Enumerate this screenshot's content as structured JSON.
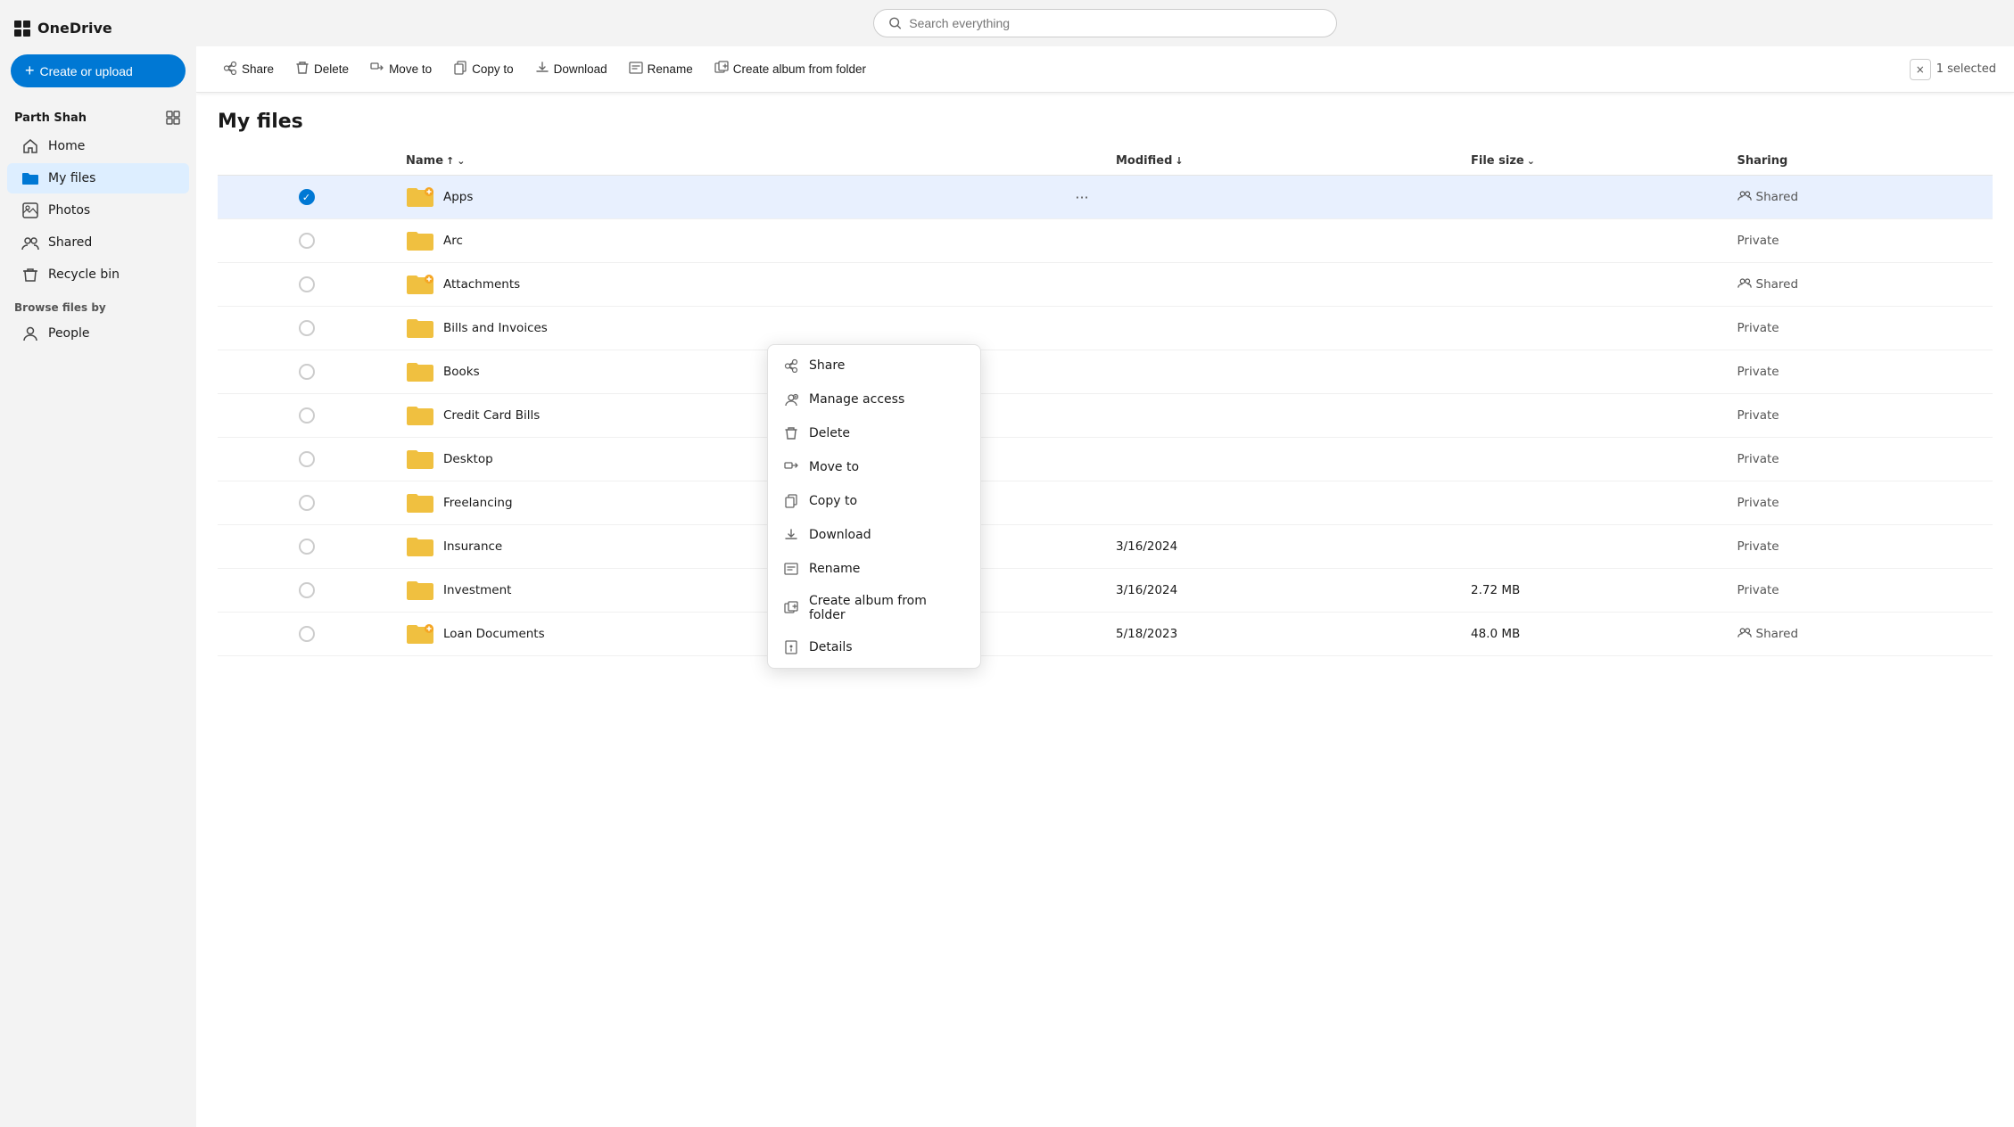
{
  "app": {
    "name": "OneDrive"
  },
  "logo": {
    "grid_icon": "grid-icon"
  },
  "create_button": {
    "label": "Create or upload",
    "plus": "+"
  },
  "user": {
    "name": "Parth Shah",
    "expand_icon": "expand-sidebar-icon"
  },
  "nav": {
    "items": [
      {
        "id": "home",
        "label": "Home",
        "icon": "home-icon"
      },
      {
        "id": "my-files",
        "label": "My files",
        "icon": "folder-icon",
        "active": true
      },
      {
        "id": "photos",
        "label": "Photos",
        "icon": "photos-icon"
      },
      {
        "id": "shared",
        "label": "Shared",
        "icon": "shared-icon"
      },
      {
        "id": "recycle-bin",
        "label": "Recycle bin",
        "icon": "recycle-icon"
      }
    ],
    "browse_label": "Browse files by",
    "browse_items": [
      {
        "id": "people",
        "label": "People",
        "icon": "people-icon"
      }
    ]
  },
  "search": {
    "placeholder": "Search everything"
  },
  "toolbar": {
    "share_label": "Share",
    "delete_label": "Delete",
    "move_to_label": "Move to",
    "copy_to_label": "Copy to",
    "download_label": "Download",
    "rename_label": "Rename",
    "create_album_label": "Create album from folder",
    "selection_text": "1 selected",
    "close_icon": "×"
  },
  "page": {
    "title": "My files"
  },
  "table": {
    "headers": {
      "name": "Name",
      "sort_asc": "↑",
      "sort_icon": "⌄",
      "modified": "Modified",
      "modified_sort": "↓",
      "file_size": "File size",
      "file_size_sort": "⌄",
      "sharing": "Sharing"
    },
    "rows": [
      {
        "id": "apps",
        "name": "Apps",
        "modified": "",
        "size": "",
        "sharing": "Shared",
        "is_shared": true,
        "special_icon": true,
        "selected": true
      },
      {
        "id": "arc",
        "name": "Arc",
        "modified": "",
        "size": "",
        "sharing": "Private",
        "is_shared": false,
        "special_icon": false,
        "selected": false
      },
      {
        "id": "attachments",
        "name": "Attachments",
        "modified": "",
        "size": "",
        "sharing": "Shared",
        "is_shared": true,
        "special_icon": true,
        "selected": false
      },
      {
        "id": "bills",
        "name": "Bills and Invoices",
        "modified": "",
        "size": "",
        "sharing": "Private",
        "is_shared": false,
        "special_icon": false,
        "selected": false
      },
      {
        "id": "books",
        "name": "Books",
        "modified": "",
        "size": "",
        "sharing": "Private",
        "is_shared": false,
        "special_icon": false,
        "selected": false
      },
      {
        "id": "credit",
        "name": "Credit Card Bills",
        "modified": "",
        "size": "",
        "sharing": "Private",
        "is_shared": false,
        "special_icon": false,
        "selected": false
      },
      {
        "id": "desktop",
        "name": "Desktop",
        "modified": "",
        "size": "",
        "sharing": "Private",
        "is_shared": false,
        "special_icon": false,
        "selected": false
      },
      {
        "id": "freelancing",
        "name": "Freelancing",
        "modified": "",
        "size": "",
        "sharing": "Private",
        "is_shared": false,
        "special_icon": false,
        "selected": false
      },
      {
        "id": "insurance",
        "name": "Insurance",
        "modified": "3/16/2024",
        "size": "",
        "sharing": "Private",
        "is_shared": false,
        "special_icon": false,
        "selected": false
      },
      {
        "id": "investment",
        "name": "Investment",
        "modified": "3/16/2024",
        "size": "2.72 MB",
        "sharing": "Private",
        "is_shared": false,
        "special_icon": false,
        "selected": false
      },
      {
        "id": "loan",
        "name": "Loan Documents",
        "modified": "5/18/2023",
        "size": "48.0 MB",
        "sharing": "Shared",
        "is_shared": true,
        "special_icon": true,
        "selected": false
      }
    ]
  },
  "context_menu": {
    "visible": true,
    "items": [
      {
        "id": "share",
        "label": "Share",
        "icon": "share-ctx-icon"
      },
      {
        "id": "manage-access",
        "label": "Manage access",
        "icon": "manage-access-icon"
      },
      {
        "id": "delete",
        "label": "Delete",
        "icon": "delete-ctx-icon"
      },
      {
        "id": "move-to",
        "label": "Move to",
        "icon": "move-to-ctx-icon"
      },
      {
        "id": "copy-to",
        "label": "Copy to",
        "icon": "copy-to-ctx-icon"
      },
      {
        "id": "download",
        "label": "Download",
        "icon": "download-ctx-icon"
      },
      {
        "id": "rename",
        "label": "Rename",
        "icon": "rename-ctx-icon"
      },
      {
        "id": "create-album",
        "label": "Create album from folder",
        "icon": "create-album-ctx-icon"
      },
      {
        "id": "details",
        "label": "Details",
        "icon": "details-ctx-icon"
      }
    ]
  }
}
